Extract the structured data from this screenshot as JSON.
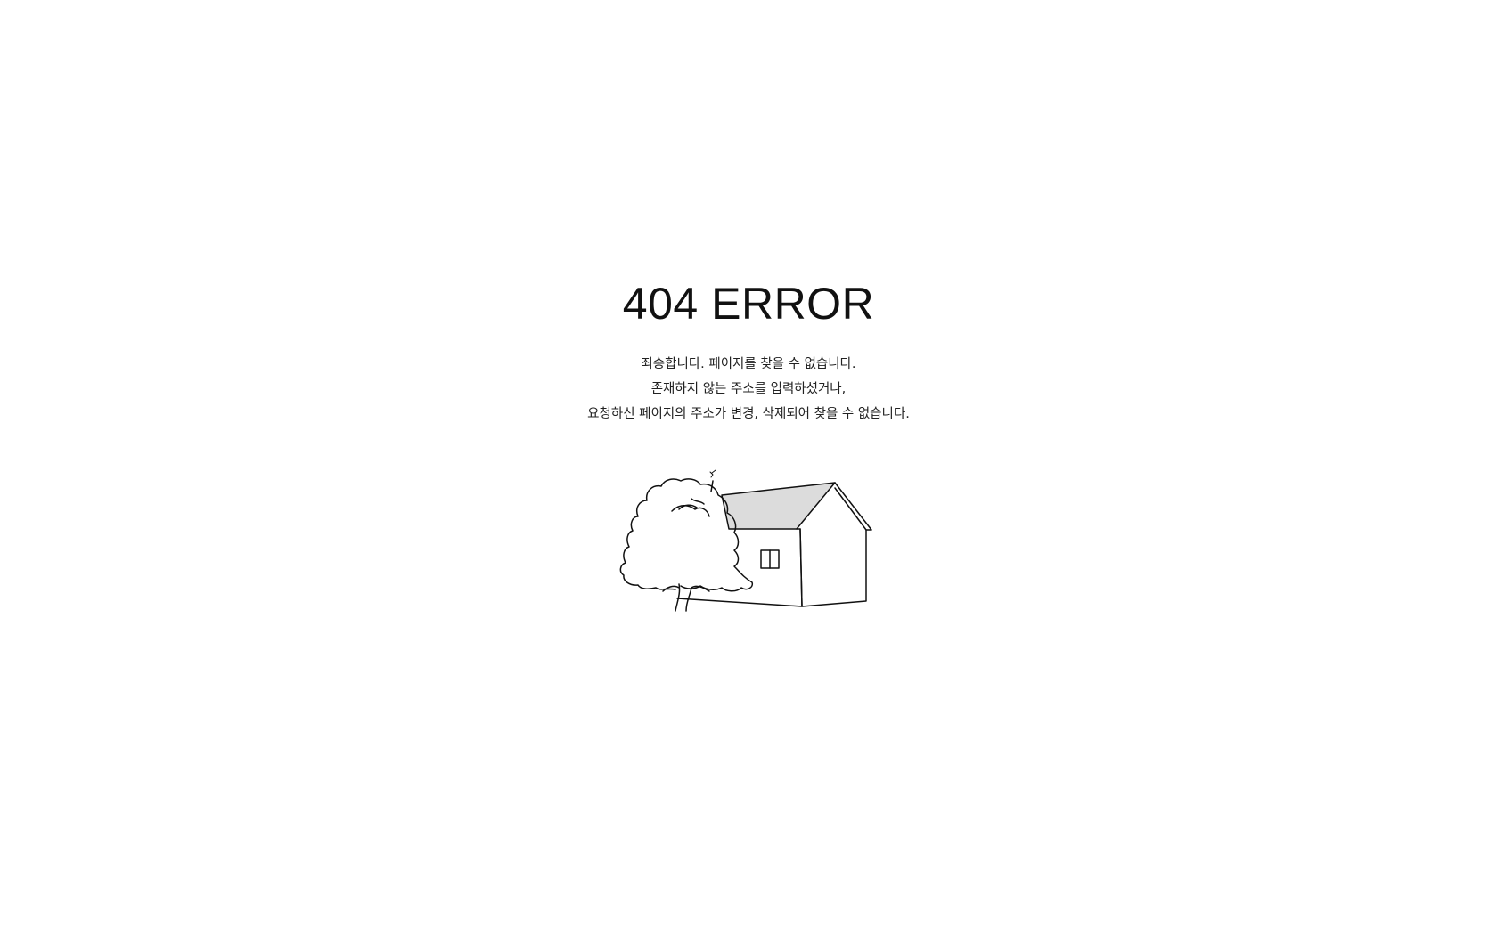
{
  "error": {
    "title": "404 ERROR",
    "lines": [
      "죄송합니다. 페이지를 찾을 수 없습니다.",
      "존재하지 않는 주소를 입력하셨거나,",
      "요청하신 페이지의 주소가 변경, 삭제되어 찾을 수 없습니다."
    ]
  },
  "colors": {
    "background": "#ffffff",
    "text": "#111111",
    "line_art": "#111111",
    "roof_fill": "#dcdcdc"
  },
  "icons": {
    "illustration": "house-and-tree-illustration"
  }
}
